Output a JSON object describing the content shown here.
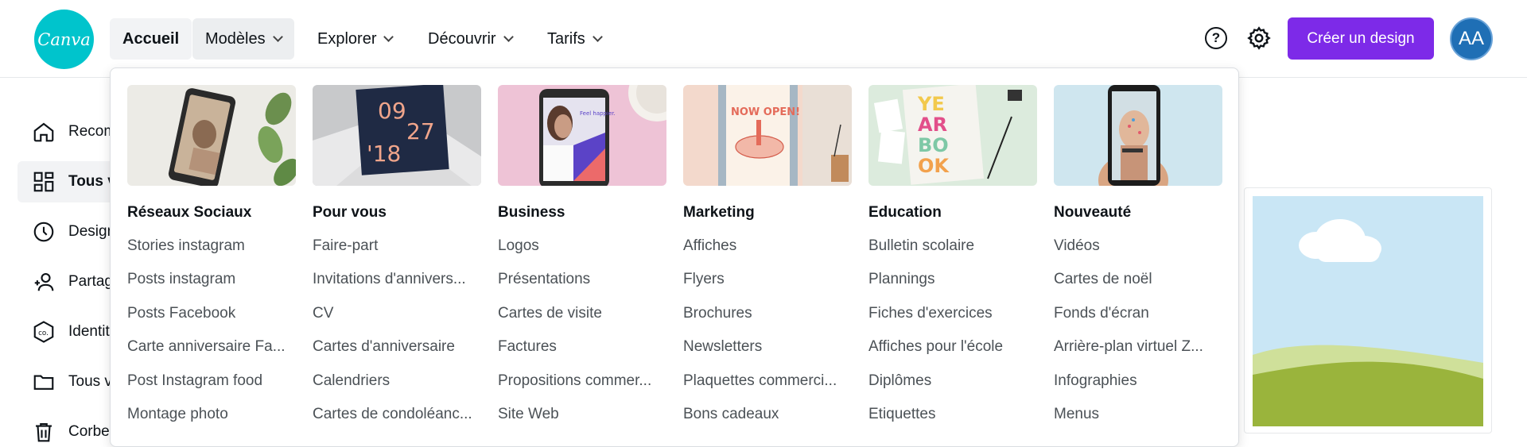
{
  "app": {
    "logo_text": "Canva"
  },
  "nav": {
    "home": "Accueil",
    "templates": "Modèles",
    "explore": "Explorer",
    "discover": "Découvrir",
    "pricing": "Tarifs"
  },
  "header": {
    "help_glyph": "?",
    "create_label": "Créer un design",
    "avatar_initials": "AA"
  },
  "sidebar": {
    "items": [
      {
        "label": "Recom",
        "icon": "home-icon"
      },
      {
        "label": "Tous v",
        "icon": "grid-icon"
      },
      {
        "label": "Design",
        "icon": "clock-icon"
      },
      {
        "label": "Partag",
        "icon": "people-icon"
      },
      {
        "label": "Identit",
        "icon": "brand-icon"
      },
      {
        "label": "Tous v",
        "icon": "folder-icon"
      },
      {
        "label": "Corbe",
        "icon": "trash-icon"
      }
    ]
  },
  "mega_menu": {
    "columns": [
      {
        "title": "Réseaux Sociaux",
        "links": [
          "Stories instagram",
          "Posts instagram",
          "Posts Facebook",
          "Carte anniversaire Fa...",
          "Post Instagram food",
          "Montage photo"
        ]
      },
      {
        "title": "Pour vous",
        "thumb_text_top": "09",
        "thumb_text_mid": "27",
        "thumb_text_bottom": "'18",
        "links": [
          "Faire-part",
          "Invitations d'annivers...",
          "CV",
          "Cartes d'anniversaire",
          "Calendriers",
          "Cartes de condoléanc..."
        ]
      },
      {
        "title": "Business",
        "thumb_text": "Feel happier.",
        "links": [
          "Logos",
          "Présentations",
          "Cartes de visite",
          "Factures",
          "Propositions commer...",
          "Site Web"
        ]
      },
      {
        "title": "Marketing",
        "thumb_text": "NOW OPEN!",
        "links": [
          "Affiches",
          "Flyers",
          "Brochures",
          "Newsletters",
          "Plaquettes commerci...",
          "Bons cadeaux"
        ]
      },
      {
        "title": "Education",
        "thumb_text": [
          "YE",
          "AR",
          "BO",
          "OK"
        ],
        "links": [
          "Bulletin scolaire",
          "Plannings",
          "Fiches d'exercices",
          "Affiches pour l'école",
          "Diplômes",
          "Etiquettes"
        ]
      },
      {
        "title": "Nouveauté",
        "links": [
          "Vidéos",
          "Cartes de noël",
          "Fonds d'écran",
          "Arrière-plan virtuel Z...",
          "Infographies",
          "Menus"
        ]
      }
    ]
  },
  "colors": {
    "brand_teal": "#00c4cc",
    "primary_purple": "#7d2ae8",
    "avatar_blue": "#1f6fb5"
  }
}
